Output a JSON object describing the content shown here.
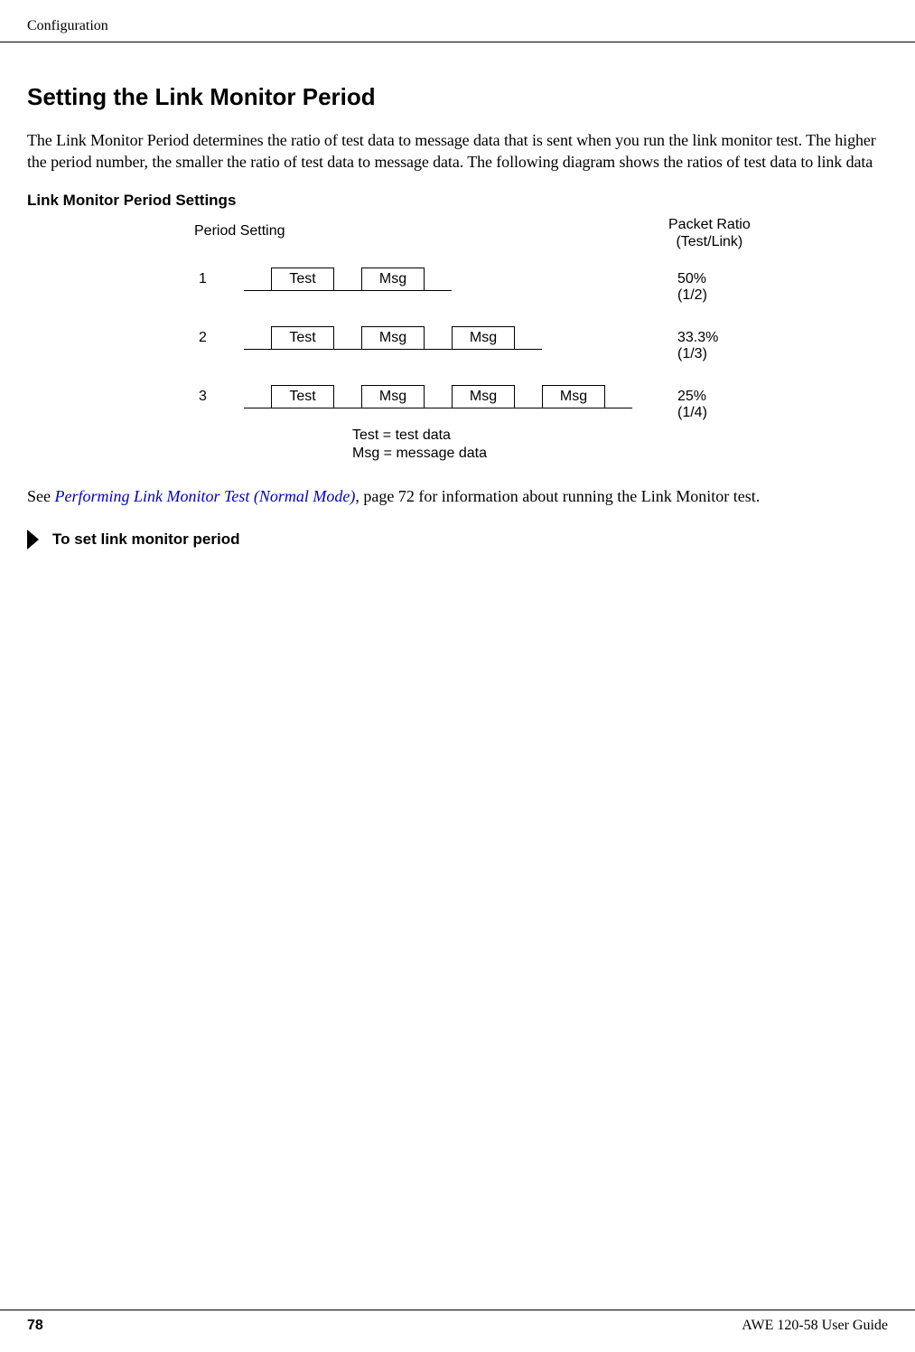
{
  "header": {
    "chapter": "Configuration"
  },
  "section": {
    "title": "Setting the Link Monitor Period",
    "intro": "The Link Monitor Period determines the ratio of test data to message data that is sent when you run the link monitor test. The higher the period number, the smaller the ratio of test data to message data. The following diagram shows the ratios of test data to link data",
    "diagram_title": "Link Monitor Period Settings"
  },
  "diagram": {
    "col_left": "Period Setting",
    "col_right_line1": "Packet Ratio",
    "col_right_line2": "(Test/Link)",
    "rows": [
      {
        "period": "1",
        "packets": [
          "Test",
          "Msg"
        ],
        "ratio": "50% (1/2)"
      },
      {
        "period": "2",
        "packets": [
          "Test",
          "Msg",
          "Msg"
        ],
        "ratio": "33.3% (1/3)"
      },
      {
        "period": "3",
        "packets": [
          "Test",
          "Msg",
          "Msg",
          "Msg"
        ],
        "ratio": "25% (1/4)"
      }
    ],
    "legend_line1": "Test = test data",
    "legend_line2": "Msg = message data"
  },
  "crossref": {
    "prefix": "See ",
    "link": "Performing Link Monitor Test (Normal Mode)",
    "suffix": ", page 72 for information about running the Link Monitor test."
  },
  "procedure": {
    "heading": "To set link monitor period"
  },
  "footer": {
    "page": "78",
    "guide": "AWE 120-58 User Guide"
  }
}
